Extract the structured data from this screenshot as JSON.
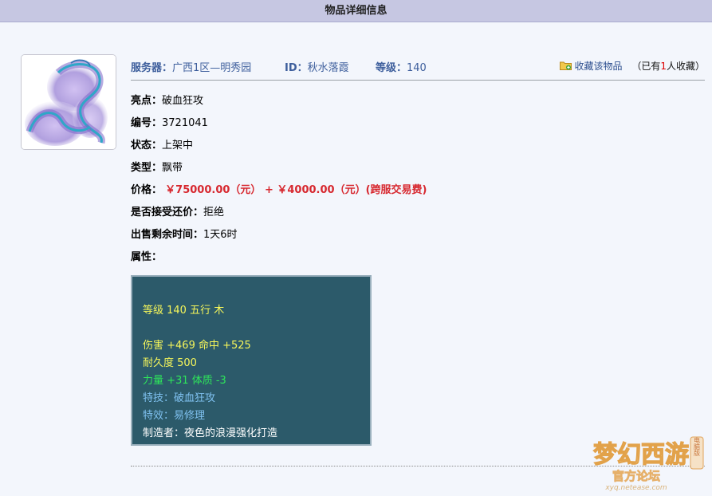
{
  "page": {
    "title": "物品详细信息"
  },
  "header": {
    "server_label": "服务器：",
    "server_value": "广西1区—明秀园",
    "id_label": "ID：",
    "id_value": "秋水落霞",
    "level_label": "等级：",
    "level_value": "140",
    "favorite_link": "收藏该物品",
    "favorite_prefix": "（已有",
    "favorite_count": "1",
    "favorite_suffix": "人收藏）"
  },
  "details": {
    "highlight_label": "亮点：",
    "highlight_value": "破血狂攻",
    "number_label": "编号：",
    "number_value": "3721041",
    "status_label": "状态：",
    "status_value": "上架中",
    "type_label": "类型：",
    "type_value": "飘带",
    "price_label": "价格：",
    "price_value": "￥75000.00（元） + ￥4000.00（元）(跨服交易费)",
    "bargain_label": "是否接受还价：",
    "bargain_value": "拒绝",
    "remaining_label": "出售剩余时间：",
    "remaining_value": "1天6时",
    "attributes_label": "属性："
  },
  "attributes": {
    "line1": "等级 140 五行 木",
    "line2": "伤害 +469 命中 +525",
    "line3": "耐久度 500",
    "line4": "力量 +31 体质 -3",
    "line5": "特技：破血狂攻",
    "line6": "特效：易修理",
    "line7": "制造者：夜色的浪漫强化打造"
  },
  "watermark": {
    "logo_text": "梦幻西游",
    "badge_text": "电脑版",
    "subtitle": "官方论坛",
    "domain": "xyq.netease.com"
  },
  "colors": {
    "title_bar": "#c6c7e2",
    "background": "#f3f6fc",
    "header_text": "#3d5e9c",
    "highlight": "#cc2222",
    "price": "#d7282f",
    "attr_bg": "#2c5a6a",
    "attr_yellow": "#f6f65a",
    "attr_green": "#2ee65a",
    "attr_blue": "#7fc1f0"
  },
  "icons": {
    "item_image": "ribbon-item-icon",
    "favorite": "folder-add-icon"
  }
}
